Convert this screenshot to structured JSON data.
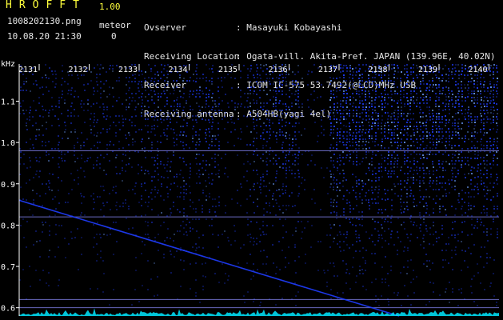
{
  "header": {
    "app_title": "HROFFT",
    "app_version": "1.00",
    "file_name": "1008202130.png",
    "date_time": "10.08.20 21:30",
    "meteor_label": "meteor",
    "meteor_count": "0",
    "info": [
      {
        "label": "Ovserver",
        "value": ": Masayuki Kobayashi"
      },
      {
        "label": "Receiving Location",
        "value": ": Ogata-vill. Akita-Pref. JAPAN (139.96E, 40.02N)"
      },
      {
        "label": "Receiver",
        "value": ": ICOM IC-575 53.7492(@LCD)MHz USB"
      },
      {
        "label": "Receiving antenna",
        "value": ": A504HB(yagi 4el)"
      }
    ]
  },
  "colors": {
    "background": "#000000",
    "header_accent": "#ffff3c",
    "signal": "#1f3dff",
    "noise_floor": "#00e8ff",
    "reference_line": "#8c8cff"
  },
  "chart_data": {
    "type": "heatmap",
    "title": "",
    "ylabel": "kHz",
    "xlabel": "",
    "x_ticks": [
      "2131",
      "2132",
      "2133",
      "2134",
      "2135",
      "2136",
      "2137",
      "2138",
      "2139",
      "2140"
    ],
    "x_range": [
      2130.6,
      2140.2
    ],
    "ylim": [
      0.58,
      1.19
    ],
    "y_ticks": [
      0.6,
      0.7,
      0.8,
      0.9,
      1.0,
      1.1
    ],
    "y_tick_labels": [
      "0.6",
      "0.7",
      "0.8",
      "0.9",
      "1.0",
      "1.1"
    ],
    "horizontal_lines_khz": [
      0.98,
      0.82,
      0.62,
      0.6
    ],
    "sweep_trace": {
      "start": [
        2130.6,
        0.86
      ],
      "end": [
        2138.2,
        0.58
      ]
    },
    "band_activity": [
      {
        "from": 2130.6,
        "to": 2133.0,
        "level": 0.35
      },
      {
        "from": 2133.0,
        "to": 2134.6,
        "level": 0.55
      },
      {
        "from": 2134.6,
        "to": 2135.2,
        "level": 0.25
      },
      {
        "from": 2135.2,
        "to": 2136.2,
        "level": 0.65
      },
      {
        "from": 2136.2,
        "to": 2136.8,
        "level": 0.2
      },
      {
        "from": 2136.8,
        "to": 2140.2,
        "level": 0.85
      }
    ]
  }
}
